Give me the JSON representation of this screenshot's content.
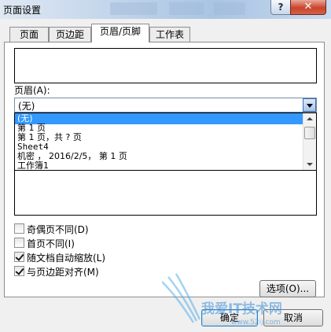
{
  "window": {
    "title": "页面设置",
    "help_label": "?",
    "close_label": "✕"
  },
  "tabs": [
    {
      "label": "页面"
    },
    {
      "label": "页边距"
    },
    {
      "label": "页眉/页脚"
    },
    {
      "label": "工作表"
    }
  ],
  "header": {
    "label": "页眉(A):",
    "selected": "(无)",
    "options": [
      "(无)",
      "第 1 页",
      "第 1 页，共 ? 页",
      "Sheet4",
      " 机密 ， 2016/2/5，  第 1 页",
      "工作簿1"
    ]
  },
  "checkboxes": [
    {
      "label": "奇偶页不同(D)",
      "checked": false
    },
    {
      "label": "首页不同(I)",
      "checked": false
    },
    {
      "label": "随文档自动缩放(L)",
      "checked": true
    },
    {
      "label": "与页边距对齐(M)",
      "checked": true
    }
  ],
  "buttons": {
    "options": "选项(O)...",
    "ok": "确定",
    "cancel": "取消"
  },
  "watermark": {
    "text": "我爱IT技术网",
    "url": "www.52ij.com"
  },
  "colors": {
    "selection": "#3399ff",
    "close": "#c8452a",
    "titlebar": "#b9cfe8"
  }
}
